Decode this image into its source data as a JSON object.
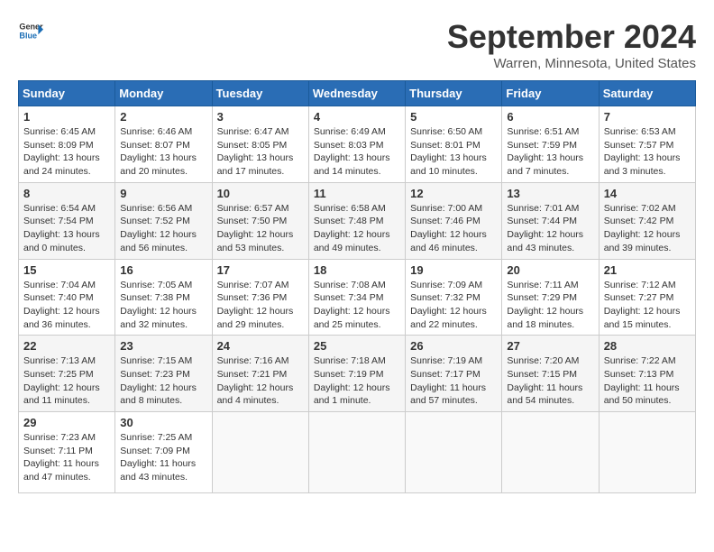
{
  "header": {
    "logo_line1": "General",
    "logo_line2": "Blue",
    "month": "September 2024",
    "location": "Warren, Minnesota, United States"
  },
  "weekdays": [
    "Sunday",
    "Monday",
    "Tuesday",
    "Wednesday",
    "Thursday",
    "Friday",
    "Saturday"
  ],
  "weeks": [
    [
      {
        "day": "1",
        "sunrise": "6:45 AM",
        "sunset": "8:09 PM",
        "daylight": "13 hours and 24 minutes."
      },
      {
        "day": "2",
        "sunrise": "6:46 AM",
        "sunset": "8:07 PM",
        "daylight": "13 hours and 20 minutes."
      },
      {
        "day": "3",
        "sunrise": "6:47 AM",
        "sunset": "8:05 PM",
        "daylight": "13 hours and 17 minutes."
      },
      {
        "day": "4",
        "sunrise": "6:49 AM",
        "sunset": "8:03 PM",
        "daylight": "13 hours and 14 minutes."
      },
      {
        "day": "5",
        "sunrise": "6:50 AM",
        "sunset": "8:01 PM",
        "daylight": "13 hours and 10 minutes."
      },
      {
        "day": "6",
        "sunrise": "6:51 AM",
        "sunset": "7:59 PM",
        "daylight": "13 hours and 7 minutes."
      },
      {
        "day": "7",
        "sunrise": "6:53 AM",
        "sunset": "7:57 PM",
        "daylight": "13 hours and 3 minutes."
      }
    ],
    [
      {
        "day": "8",
        "sunrise": "6:54 AM",
        "sunset": "7:54 PM",
        "daylight": "13 hours and 0 minutes."
      },
      {
        "day": "9",
        "sunrise": "6:56 AM",
        "sunset": "7:52 PM",
        "daylight": "12 hours and 56 minutes."
      },
      {
        "day": "10",
        "sunrise": "6:57 AM",
        "sunset": "7:50 PM",
        "daylight": "12 hours and 53 minutes."
      },
      {
        "day": "11",
        "sunrise": "6:58 AM",
        "sunset": "7:48 PM",
        "daylight": "12 hours and 49 minutes."
      },
      {
        "day": "12",
        "sunrise": "7:00 AM",
        "sunset": "7:46 PM",
        "daylight": "12 hours and 46 minutes."
      },
      {
        "day": "13",
        "sunrise": "7:01 AM",
        "sunset": "7:44 PM",
        "daylight": "12 hours and 43 minutes."
      },
      {
        "day": "14",
        "sunrise": "7:02 AM",
        "sunset": "7:42 PM",
        "daylight": "12 hours and 39 minutes."
      }
    ],
    [
      {
        "day": "15",
        "sunrise": "7:04 AM",
        "sunset": "7:40 PM",
        "daylight": "12 hours and 36 minutes."
      },
      {
        "day": "16",
        "sunrise": "7:05 AM",
        "sunset": "7:38 PM",
        "daylight": "12 hours and 32 minutes."
      },
      {
        "day": "17",
        "sunrise": "7:07 AM",
        "sunset": "7:36 PM",
        "daylight": "12 hours and 29 minutes."
      },
      {
        "day": "18",
        "sunrise": "7:08 AM",
        "sunset": "7:34 PM",
        "daylight": "12 hours and 25 minutes."
      },
      {
        "day": "19",
        "sunrise": "7:09 AM",
        "sunset": "7:32 PM",
        "daylight": "12 hours and 22 minutes."
      },
      {
        "day": "20",
        "sunrise": "7:11 AM",
        "sunset": "7:29 PM",
        "daylight": "12 hours and 18 minutes."
      },
      {
        "day": "21",
        "sunrise": "7:12 AM",
        "sunset": "7:27 PM",
        "daylight": "12 hours and 15 minutes."
      }
    ],
    [
      {
        "day": "22",
        "sunrise": "7:13 AM",
        "sunset": "7:25 PM",
        "daylight": "12 hours and 11 minutes."
      },
      {
        "day": "23",
        "sunrise": "7:15 AM",
        "sunset": "7:23 PM",
        "daylight": "12 hours and 8 minutes."
      },
      {
        "day": "24",
        "sunrise": "7:16 AM",
        "sunset": "7:21 PM",
        "daylight": "12 hours and 4 minutes."
      },
      {
        "day": "25",
        "sunrise": "7:18 AM",
        "sunset": "7:19 PM",
        "daylight": "12 hours and 1 minute."
      },
      {
        "day": "26",
        "sunrise": "7:19 AM",
        "sunset": "7:17 PM",
        "daylight": "11 hours and 57 minutes."
      },
      {
        "day": "27",
        "sunrise": "7:20 AM",
        "sunset": "7:15 PM",
        "daylight": "11 hours and 54 minutes."
      },
      {
        "day": "28",
        "sunrise": "7:22 AM",
        "sunset": "7:13 PM",
        "daylight": "11 hours and 50 minutes."
      }
    ],
    [
      {
        "day": "29",
        "sunrise": "7:23 AM",
        "sunset": "7:11 PM",
        "daylight": "11 hours and 47 minutes."
      },
      {
        "day": "30",
        "sunrise": "7:25 AM",
        "sunset": "7:09 PM",
        "daylight": "11 hours and 43 minutes."
      },
      null,
      null,
      null,
      null,
      null
    ]
  ]
}
